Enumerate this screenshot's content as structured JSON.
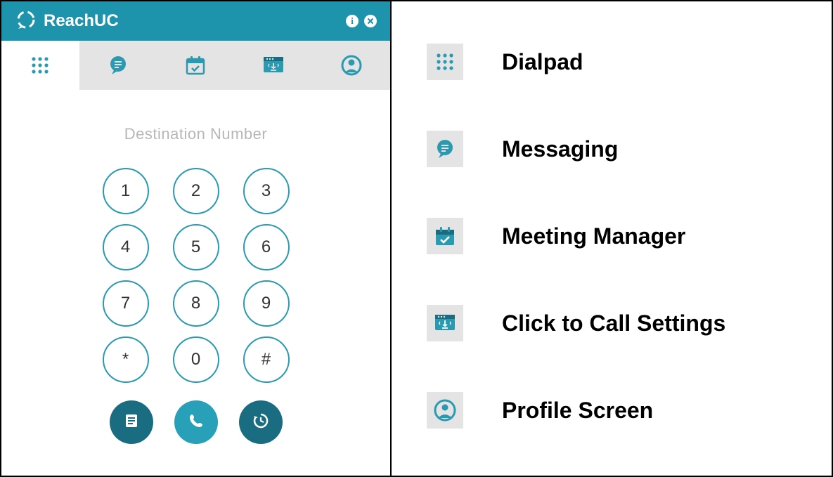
{
  "brand": {
    "name": "ReachUC"
  },
  "header_actions": {
    "info": "info",
    "close": "close"
  },
  "tabs": [
    {
      "id": "dialpad",
      "active": true
    },
    {
      "id": "messaging",
      "active": false
    },
    {
      "id": "meeting",
      "active": false
    },
    {
      "id": "click-to-call",
      "active": false
    },
    {
      "id": "profile",
      "active": false
    }
  ],
  "dialpad": {
    "placeholder": "Destination Number",
    "keys": [
      "1",
      "2",
      "3",
      "4",
      "5",
      "6",
      "7",
      "8",
      "9",
      "*",
      "0",
      "#"
    ],
    "actions": [
      "contacts",
      "call",
      "history"
    ]
  },
  "legend": [
    {
      "icon": "dialpad",
      "label": "Dialpad"
    },
    {
      "icon": "messaging",
      "label": "Messaging"
    },
    {
      "icon": "meeting",
      "label": "Meeting Manager"
    },
    {
      "icon": "click-to-call",
      "label": "Click to Call Settings"
    },
    {
      "icon": "profile",
      "label": "Profile Screen"
    }
  ],
  "colors": {
    "accent": "#1d94ac",
    "accent_dark": "#1a6d80",
    "tab_bg": "#e4e4e4"
  }
}
